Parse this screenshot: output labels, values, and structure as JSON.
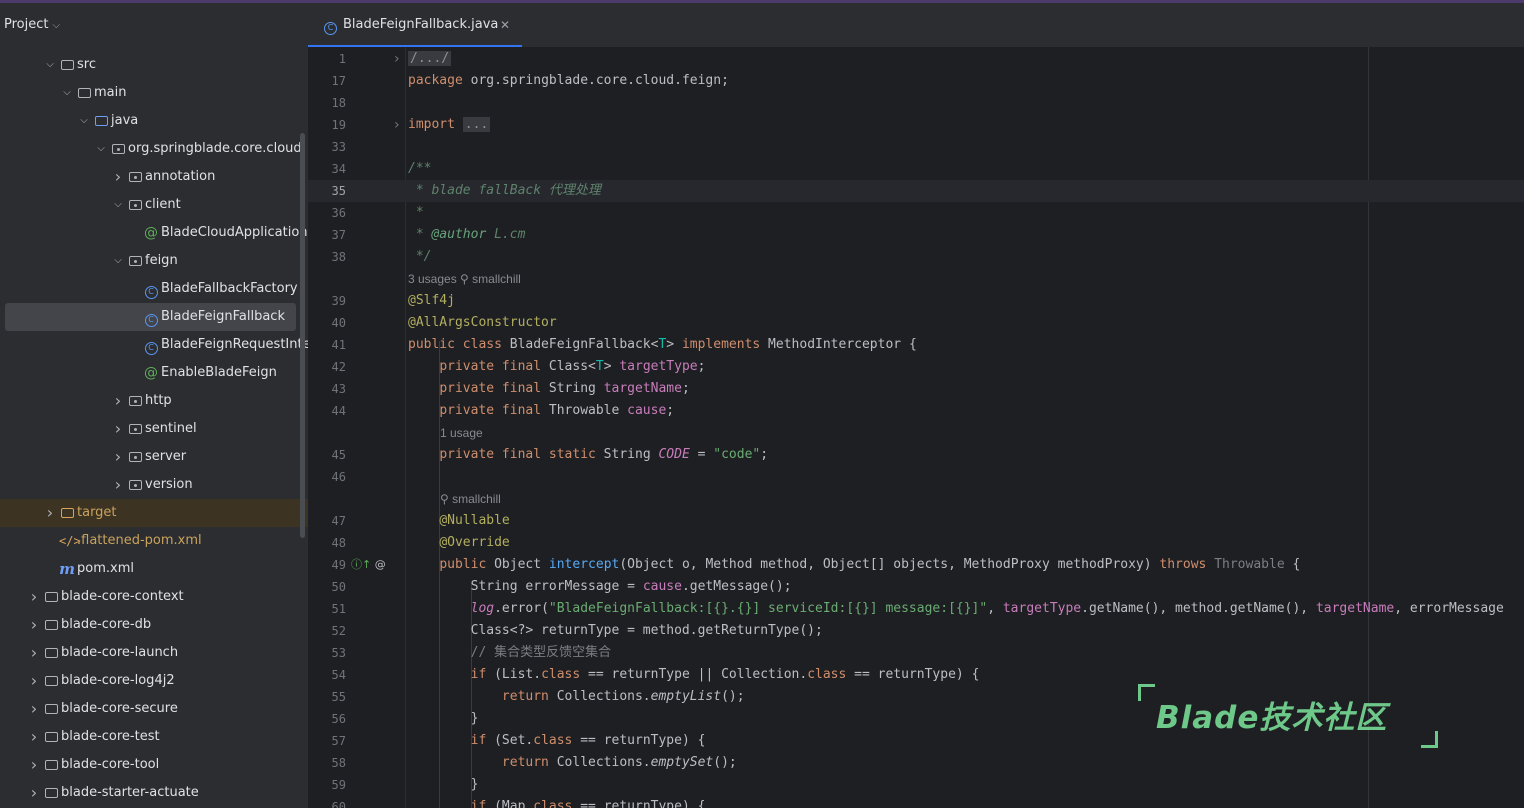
{
  "sidebar": {
    "title": "Project",
    "tree": [
      {
        "label": "src",
        "type": "folder",
        "level": 2,
        "expanded": true
      },
      {
        "label": "main",
        "type": "folder",
        "level": 3,
        "expanded": true
      },
      {
        "label": "java",
        "type": "src-folder",
        "level": 4,
        "expanded": true
      },
      {
        "label": "org.springblade.core.cloud",
        "type": "package",
        "level": 5,
        "expanded": true
      },
      {
        "label": "annotation",
        "type": "package",
        "level": 6,
        "expanded": false
      },
      {
        "label": "client",
        "type": "package",
        "level": 6,
        "expanded": true
      },
      {
        "label": "BladeCloudApplication",
        "type": "annotation",
        "level": 7
      },
      {
        "label": "feign",
        "type": "package",
        "level": 6,
        "expanded": true
      },
      {
        "label": "BladeFallbackFactory",
        "type": "class",
        "level": 7
      },
      {
        "label": "BladeFeignFallback",
        "type": "class",
        "level": 7,
        "selected": true
      },
      {
        "label": "BladeFeignRequestInte",
        "type": "class",
        "level": 7
      },
      {
        "label": "EnableBladeFeign",
        "type": "annotation",
        "level": 7
      },
      {
        "label": "http",
        "type": "package",
        "level": 6,
        "expanded": false
      },
      {
        "label": "sentinel",
        "type": "package",
        "level": 6,
        "expanded": false
      },
      {
        "label": "server",
        "type": "package",
        "level": 6,
        "expanded": false
      },
      {
        "label": "version",
        "type": "package",
        "level": 6,
        "expanded": false
      },
      {
        "label": "target",
        "type": "excluded-folder",
        "level": 2,
        "expanded": false
      },
      {
        "label": ".flattened-pom.xml",
        "type": "xml",
        "level": 2
      },
      {
        "label": "pom.xml",
        "type": "maven",
        "level": 2
      },
      {
        "label": "blade-core-context",
        "type": "module",
        "level": 1,
        "expanded": false
      },
      {
        "label": "blade-core-db",
        "type": "module",
        "level": 1,
        "expanded": false
      },
      {
        "label": "blade-core-launch",
        "type": "module",
        "level": 1,
        "expanded": false
      },
      {
        "label": "blade-core-log4j2",
        "type": "module",
        "level": 1,
        "expanded": false
      },
      {
        "label": "blade-core-secure",
        "type": "module",
        "level": 1,
        "expanded": false
      },
      {
        "label": "blade-core-test",
        "type": "module",
        "level": 1,
        "expanded": false
      },
      {
        "label": "blade-core-tool",
        "type": "module",
        "level": 1,
        "expanded": false
      },
      {
        "label": "blade-starter-actuate",
        "type": "module",
        "level": 1,
        "expanded": false
      }
    ]
  },
  "tabs": [
    {
      "label": "BladeFeignFallback.java",
      "active": true
    }
  ],
  "editor": {
    "current_line": "35",
    "lines": [
      {
        "ln": "1",
        "fold": true,
        "segs": [
          [
            "foldbox",
            "/.../"
          ]
        ]
      },
      {
        "ln": "17",
        "segs": [
          [
            "kw",
            "package"
          ],
          [
            "",
            " org.springblade.core.cloud.feign;"
          ]
        ]
      },
      {
        "ln": "18",
        "segs": []
      },
      {
        "ln": "19",
        "fold": true,
        "segs": [
          [
            "kw",
            "import"
          ],
          [
            "",
            " "
          ],
          [
            "foldbox",
            "..."
          ]
        ]
      },
      {
        "ln": "33",
        "segs": []
      },
      {
        "ln": "34",
        "segs": [
          [
            "doc",
            "/**"
          ]
        ]
      },
      {
        "ln": "35",
        "segs": [
          [
            "doc",
            " * blade fallBack 代理处理"
          ]
        ]
      },
      {
        "ln": "36",
        "segs": [
          [
            "doc",
            " *"
          ]
        ]
      },
      {
        "ln": "37",
        "segs": [
          [
            "doc",
            " * "
          ],
          [
            "doctag",
            "@author"
          ],
          [
            "doc",
            " L.cm"
          ]
        ]
      },
      {
        "ln": "38",
        "segs": [
          [
            "doc",
            " */"
          ]
        ]
      },
      {
        "hint": "3 usages   ⚲ smallchill",
        "indent": 0
      },
      {
        "ln": "39",
        "segs": [
          [
            "an",
            "@Slf4j"
          ]
        ]
      },
      {
        "ln": "40",
        "segs": [
          [
            "an",
            "@AllArgsConstructor"
          ]
        ]
      },
      {
        "ln": "41",
        "segs": [
          [
            "kw",
            "public class"
          ],
          [
            "",
            " BladeFeignFallback<"
          ],
          [
            "tp",
            "T"
          ],
          [
            "",
            "> "
          ],
          [
            "kw",
            "implements"
          ],
          [
            "",
            " MethodInterceptor {"
          ]
        ]
      },
      {
        "ln": "42",
        "segs": [
          [
            "",
            "    "
          ],
          [
            "kw",
            "private final"
          ],
          [
            "",
            " Class<"
          ],
          [
            "tp",
            "T"
          ],
          [
            "",
            "> "
          ],
          [
            "fld",
            "targetType"
          ],
          [
            "",
            ";"
          ]
        ]
      },
      {
        "ln": "43",
        "segs": [
          [
            "",
            "    "
          ],
          [
            "kw",
            "private final"
          ],
          [
            "",
            " String "
          ],
          [
            "fld",
            "targetName"
          ],
          [
            "",
            ";"
          ]
        ]
      },
      {
        "ln": "44",
        "segs": [
          [
            "",
            "    "
          ],
          [
            "kw",
            "private final"
          ],
          [
            "",
            " Throwable "
          ],
          [
            "fld",
            "cause"
          ],
          [
            "",
            ";"
          ]
        ]
      },
      {
        "hint": "1 usage",
        "indent": 4
      },
      {
        "ln": "45",
        "segs": [
          [
            "",
            "    "
          ],
          [
            "kw",
            "private final static"
          ],
          [
            "",
            " String "
          ],
          [
            "const",
            "CODE"
          ],
          [
            "",
            " = "
          ],
          [
            "str",
            "\"code\""
          ],
          [
            "",
            ";"
          ]
        ]
      },
      {
        "ln": "46",
        "segs": []
      },
      {
        "hint": "⚲ smallchill",
        "indent": 4
      },
      {
        "ln": "47",
        "segs": [
          [
            "",
            "    "
          ],
          [
            "an",
            "@Nullable"
          ]
        ]
      },
      {
        "ln": "48",
        "segs": [
          [
            "",
            "    "
          ],
          [
            "an",
            "@Override"
          ]
        ]
      },
      {
        "ln": "49",
        "icons": true,
        "segs": [
          [
            "",
            "    "
          ],
          [
            "kw",
            "public"
          ],
          [
            "",
            " Object "
          ],
          [
            "fn",
            "intercept"
          ],
          [
            "",
            "(Object o, Method method, Object[] objects, MethodProxy methodProxy) "
          ],
          [
            "kw",
            "throws"
          ],
          [
            "gray",
            " Throwable"
          ],
          [
            "",
            " {"
          ]
        ]
      },
      {
        "ln": "50",
        "segs": [
          [
            "",
            "        String errorMessage = "
          ],
          [
            "fld",
            "cause"
          ],
          [
            "",
            ".getMessage();"
          ]
        ]
      },
      {
        "ln": "51",
        "segs": [
          [
            "",
            "        "
          ],
          [
            "fld it",
            "log"
          ],
          [
            "",
            ".error("
          ],
          [
            "str",
            "\"BladeFeignFallback:[{}.{}] serviceId:[{}] message:[{}]\""
          ],
          [
            "",
            ", "
          ],
          [
            "fld",
            "targetType"
          ],
          [
            "",
            ".getName(), method.getName(), "
          ],
          [
            "fld",
            "targetName"
          ],
          [
            "",
            ", errorMessage"
          ]
        ]
      },
      {
        "ln": "52",
        "segs": [
          [
            "",
            "        Class<?> returnType = method.getReturnType();"
          ]
        ]
      },
      {
        "ln": "53",
        "segs": [
          [
            "cmt",
            "        // 集合类型反馈空集合"
          ]
        ]
      },
      {
        "ln": "54",
        "segs": [
          [
            "",
            "        "
          ],
          [
            "kw",
            "if"
          ],
          [
            "",
            " (List."
          ],
          [
            "kw",
            "class"
          ],
          [
            "",
            " == returnType || Collection."
          ],
          [
            "kw",
            "class"
          ],
          [
            "",
            " == returnType) {"
          ]
        ]
      },
      {
        "ln": "55",
        "segs": [
          [
            "",
            "            "
          ],
          [
            "kw",
            "return"
          ],
          [
            "",
            " Collections."
          ],
          [
            "it",
            "emptyList"
          ],
          [
            "",
            "();"
          ]
        ]
      },
      {
        "ln": "56",
        "segs": [
          [
            "",
            "        }"
          ]
        ]
      },
      {
        "ln": "57",
        "segs": [
          [
            "",
            "        "
          ],
          [
            "kw",
            "if"
          ],
          [
            "",
            " (Set."
          ],
          [
            "kw",
            "class"
          ],
          [
            "",
            " == returnType) {"
          ]
        ]
      },
      {
        "ln": "58",
        "segs": [
          [
            "",
            "            "
          ],
          [
            "kw",
            "return"
          ],
          [
            "",
            " Collections."
          ],
          [
            "it",
            "emptySet"
          ],
          [
            "",
            "();"
          ]
        ]
      },
      {
        "ln": "59",
        "segs": [
          [
            "",
            "        }"
          ]
        ]
      },
      {
        "ln": "60",
        "segs": [
          [
            "",
            "        "
          ],
          [
            "kw",
            "if"
          ],
          [
            "",
            " (Map."
          ],
          [
            "kw",
            "class"
          ],
          [
            "",
            " == returnType) {"
          ]
        ]
      }
    ]
  },
  "watermark": "Blade技术社区",
  "colors": {
    "accent": "#3574f0",
    "keyword": "#cf8e6d",
    "annotation": "#b3ae60",
    "field": "#c77dbb",
    "string": "#6aab73",
    "watermark": "#6ec889"
  }
}
